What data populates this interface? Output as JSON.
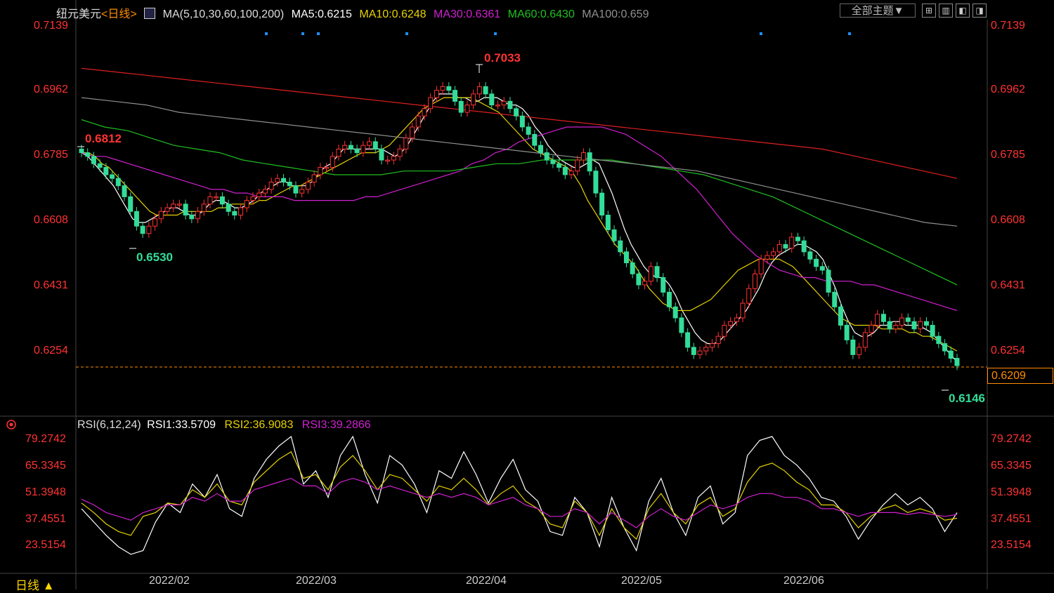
{
  "header": {
    "symbol": "纽元美元",
    "period": "<日线>",
    "ma_label": "MA(5,10,30,60,100,200)",
    "ma5": "MA5:0.6215",
    "ma10": "MA10:0.6248",
    "ma30": "MA30:0.6361",
    "ma60": "MA60:0.6430",
    "ma100": "MA100:0.659",
    "theme_button": "全部主题▼",
    "tool_icons": [
      "grid-icon",
      "layout-icon",
      "panel-left-icon",
      "panel-right-icon"
    ]
  },
  "colors": {
    "up": "#ff3333",
    "down": "#33dd99",
    "ma5": "#ffffff",
    "ma10": "#e6d200",
    "ma30": "#d020d0",
    "ma60": "#20c020",
    "ma100": "#909090",
    "ma200": "#e02020",
    "last_line": "#ff8c00"
  },
  "price_axis": {
    "ticks": [
      "0.7139",
      "0.6962",
      "0.6785",
      "0.6608",
      "0.6431",
      "0.6254"
    ],
    "last_price": "0.6209"
  },
  "annotations": {
    "high": "0.7033",
    "low_left": "0.6530",
    "left_start": "0.6812",
    "recent_low": "0.6146"
  },
  "rsi": {
    "label": "RSI(6,12,24)",
    "rsi1": "RSI1:33.5709",
    "rsi2": "RSI2:36.9083",
    "rsi3": "RSI3:39.2866",
    "ticks": [
      "79.2742",
      "65.3345",
      "51.3948",
      "37.4551",
      "23.5154"
    ]
  },
  "x_axis": {
    "dates": [
      "2022/02",
      "2022/03",
      "2022/04",
      "2022/05",
      "2022/06"
    ]
  },
  "footer": {
    "period_button": "日线 ▲"
  },
  "chart_data": [
    {
      "type": "candlestick",
      "title": "纽元美元 <日线>",
      "ylim": [
        0.612,
        0.716
      ],
      "series": [
        {
          "name": "close",
          "values": [
            0.679,
            0.678,
            0.676,
            0.675,
            0.673,
            0.672,
            0.67,
            0.667,
            0.663,
            0.659,
            0.657,
            0.659,
            0.661,
            0.663,
            0.664,
            0.665,
            0.665,
            0.662,
            0.661,
            0.663,
            0.665,
            0.667,
            0.667,
            0.665,
            0.663,
            0.662,
            0.664,
            0.666,
            0.667,
            0.668,
            0.669,
            0.671,
            0.672,
            0.671,
            0.67,
            0.668,
            0.669,
            0.671,
            0.673,
            0.675,
            0.675,
            0.678,
            0.68,
            0.681,
            0.68,
            0.679,
            0.681,
            0.682,
            0.68,
            0.677,
            0.677,
            0.678,
            0.68,
            0.683,
            0.686,
            0.689,
            0.691,
            0.694,
            0.696,
            0.697,
            0.696,
            0.693,
            0.69,
            0.692,
            0.695,
            0.697,
            0.695,
            0.692,
            0.692,
            0.693,
            0.691,
            0.689,
            0.686,
            0.684,
            0.681,
            0.679,
            0.677,
            0.676,
            0.675,
            0.673,
            0.674,
            0.677,
            0.679,
            0.674,
            0.668,
            0.662,
            0.658,
            0.655,
            0.652,
            0.649,
            0.646,
            0.643,
            0.644,
            0.648,
            0.645,
            0.641,
            0.637,
            0.634,
            0.63,
            0.626,
            0.624,
            0.625,
            0.626,
            0.627,
            0.629,
            0.632,
            0.633,
            0.634,
            0.638,
            0.642,
            0.646,
            0.65,
            0.651,
            0.652,
            0.654,
            0.653,
            0.656,
            0.655,
            0.652,
            0.65,
            0.648,
            0.647,
            0.641,
            0.637,
            0.632,
            0.628,
            0.624,
            0.626,
            0.63,
            0.632,
            0.635,
            0.633,
            0.631,
            0.632,
            0.634,
            0.633,
            0.631,
            0.633,
            0.632,
            0.629,
            0.627,
            0.625,
            0.623,
            0.621
          ]
        },
        {
          "name": "MA5",
          "values": [
            0.679,
            0.678,
            0.676,
            0.674,
            0.672,
            0.67,
            0.667,
            0.664,
            0.661,
            0.66,
            0.66,
            0.661,
            0.662,
            0.663,
            0.664,
            0.664,
            0.663,
            0.662,
            0.662,
            0.663,
            0.665,
            0.666,
            0.666,
            0.665,
            0.664,
            0.664,
            0.665,
            0.666,
            0.668,
            0.669,
            0.67,
            0.671,
            0.671,
            0.67,
            0.67,
            0.67,
            0.671,
            0.673,
            0.675,
            0.676,
            0.678,
            0.68,
            0.68,
            0.68,
            0.68,
            0.68,
            0.68,
            0.68,
            0.679,
            0.678,
            0.679,
            0.681,
            0.684,
            0.687,
            0.69,
            0.693,
            0.695,
            0.695,
            0.695,
            0.694,
            0.694,
            0.693,
            0.693,
            0.694,
            0.694,
            0.694,
            0.693,
            0.692,
            0.692,
            0.691,
            0.689,
            0.686,
            0.684,
            0.681,
            0.679,
            0.677,
            0.676,
            0.675,
            0.675,
            0.676,
            0.677,
            0.676,
            0.672,
            0.668,
            0.663,
            0.658,
            0.654,
            0.651,
            0.648,
            0.646,
            0.645,
            0.645,
            0.643,
            0.64,
            0.636,
            0.633,
            0.63,
            0.628,
            0.627,
            0.627,
            0.628,
            0.63,
            0.632,
            0.634,
            0.636,
            0.639,
            0.642,
            0.646,
            0.649,
            0.651,
            0.652,
            0.653,
            0.654,
            0.654,
            0.653,
            0.652,
            0.65,
            0.646,
            0.642,
            0.637,
            0.633,
            0.63,
            0.629,
            0.629,
            0.63,
            0.632,
            0.632,
            0.633,
            0.633,
            0.632,
            0.632,
            0.632,
            0.631,
            0.63,
            0.628,
            0.626,
            0.624,
            0.622
          ]
        },
        {
          "name": "MA10",
          "values": [
            0.679,
            0.679,
            0.678,
            0.676,
            0.675,
            0.673,
            0.671,
            0.669,
            0.667,
            0.665,
            0.663,
            0.662,
            0.662,
            0.662,
            0.662,
            0.663,
            0.663,
            0.663,
            0.663,
            0.663,
            0.664,
            0.664,
            0.665,
            0.665,
            0.665,
            0.665,
            0.666,
            0.666,
            0.667,
            0.668,
            0.669,
            0.67,
            0.67,
            0.671,
            0.672,
            0.673,
            0.674,
            0.675,
            0.676,
            0.677,
            0.678,
            0.679,
            0.679,
            0.679,
            0.68,
            0.681,
            0.683,
            0.685,
            0.687,
            0.689,
            0.691,
            0.692,
            0.693,
            0.694,
            0.694,
            0.694,
            0.694,
            0.694,
            0.693,
            0.692,
            0.691,
            0.69,
            0.688,
            0.686,
            0.684,
            0.682,
            0.68,
            0.679,
            0.678,
            0.677,
            0.676,
            0.675,
            0.673,
            0.67,
            0.666,
            0.663,
            0.66,
            0.657,
            0.654,
            0.652,
            0.65,
            0.648,
            0.645,
            0.642,
            0.64,
            0.638,
            0.637,
            0.636,
            0.636,
            0.636,
            0.637,
            0.638,
            0.639,
            0.641,
            0.643,
            0.645,
            0.647,
            0.648,
            0.649,
            0.65,
            0.65,
            0.65,
            0.65,
            0.649,
            0.648,
            0.646,
            0.644,
            0.642,
            0.64,
            0.638,
            0.636,
            0.634,
            0.633,
            0.632,
            0.632,
            0.632,
            0.632,
            0.631,
            0.631,
            0.631,
            0.631,
            0.63,
            0.63,
            0.629,
            0.629,
            0.628,
            0.627,
            0.626,
            0.625
          ]
        },
        {
          "name": "MA30",
          "values": [
            0.679,
            0.678,
            0.678,
            0.677,
            0.676,
            0.675,
            0.674,
            0.673,
            0.672,
            0.671,
            0.67,
            0.669,
            0.669,
            0.668,
            0.668,
            0.667,
            0.667,
            0.667,
            0.666,
            0.666,
            0.666,
            0.666,
            0.666,
            0.666,
            0.667,
            0.667,
            0.668,
            0.669,
            0.67,
            0.671,
            0.672,
            0.673,
            0.674,
            0.676,
            0.677,
            0.679,
            0.68,
            0.682,
            0.683,
            0.684,
            0.685,
            0.686,
            0.686,
            0.686,
            0.686,
            0.685,
            0.684,
            0.682,
            0.68,
            0.678,
            0.675,
            0.672,
            0.669,
            0.665,
            0.661,
            0.657,
            0.654,
            0.651,
            0.649,
            0.647,
            0.646,
            0.645,
            0.645,
            0.644,
            0.644,
            0.644,
            0.643,
            0.643,
            0.642,
            0.641,
            0.64,
            0.639,
            0.638,
            0.637,
            0.636
          ]
        },
        {
          "name": "MA60",
          "values": [
            0.688,
            0.686,
            0.685,
            0.683,
            0.681,
            0.68,
            0.679,
            0.677,
            0.676,
            0.675,
            0.674,
            0.673,
            0.673,
            0.673,
            0.674,
            0.674,
            0.674,
            0.675,
            0.676,
            0.676,
            0.677,
            0.677,
            0.677,
            0.677,
            0.676,
            0.675,
            0.674,
            0.673,
            0.671,
            0.669,
            0.667,
            0.664,
            0.661,
            0.658,
            0.655,
            0.652,
            0.649,
            0.646,
            0.643
          ]
        },
        {
          "name": "MA100",
          "values": [
            0.694,
            0.693,
            0.692,
            0.69,
            0.689,
            0.688,
            0.687,
            0.686,
            0.685,
            0.684,
            0.683,
            0.682,
            0.681,
            0.68,
            0.679,
            0.678,
            0.677,
            0.676,
            0.675,
            0.674,
            0.672,
            0.67,
            0.668,
            0.666,
            0.664,
            0.662,
            0.66,
            0.659
          ]
        },
        {
          "name": "MA200",
          "values": [
            0.702,
            0.701,
            0.7,
            0.699,
            0.698,
            0.697,
            0.696,
            0.695,
            0.694,
            0.693,
            0.692,
            0.691,
            0.69,
            0.689,
            0.688,
            0.687,
            0.686,
            0.685,
            0.684,
            0.683,
            0.682,
            0.681,
            0.68,
            0.678,
            0.676,
            0.674,
            0.672
          ]
        }
      ]
    },
    {
      "type": "line",
      "title": "RSI(6,12,24)",
      "ylim": [
        15,
        85
      ],
      "series": [
        {
          "name": "RSI1",
          "values": [
            42,
            35,
            28,
            22,
            18,
            20,
            35,
            45,
            40,
            55,
            48,
            60,
            42,
            38,
            58,
            68,
            75,
            80,
            55,
            62,
            48,
            70,
            80,
            60,
            45,
            70,
            65,
            55,
            40,
            62,
            58,
            72,
            60,
            45,
            58,
            68,
            52,
            46,
            30,
            28,
            48,
            40,
            22,
            48,
            32,
            20,
            46,
            58,
            40,
            28,
            48,
            54,
            34,
            40,
            70,
            78,
            80,
            70,
            65,
            58,
            48,
            46,
            38,
            26,
            36,
            44,
            50,
            44,
            48,
            42,
            30,
            40
          ]
        },
        {
          "name": "RSI2",
          "values": [
            45,
            40,
            34,
            30,
            28,
            38,
            40,
            45,
            44,
            52,
            48,
            55,
            46,
            44,
            56,
            62,
            68,
            72,
            58,
            60,
            52,
            64,
            70,
            62,
            52,
            60,
            58,
            52,
            46,
            54,
            52,
            58,
            52,
            44,
            50,
            54,
            46,
            42,
            34,
            32,
            46,
            40,
            28,
            42,
            32,
            26,
            42,
            50,
            40,
            34,
            44,
            48,
            38,
            42,
            56,
            64,
            66,
            62,
            56,
            52,
            44,
            44,
            40,
            32,
            38,
            42,
            44,
            40,
            42,
            40,
            36,
            37
          ]
        },
        {
          "name": "RSI3",
          "values": [
            47,
            44,
            40,
            38,
            36,
            40,
            42,
            44,
            44,
            48,
            46,
            50,
            46,
            46,
            52,
            54,
            56,
            58,
            54,
            54,
            50,
            56,
            58,
            56,
            52,
            54,
            52,
            50,
            48,
            50,
            48,
            50,
            48,
            44,
            46,
            48,
            44,
            42,
            38,
            38,
            42,
            40,
            34,
            40,
            36,
            32,
            38,
            42,
            38,
            36,
            40,
            44,
            42,
            44,
            48,
            50,
            50,
            48,
            48,
            46,
            42,
            42,
            40,
            38,
            40,
            40,
            40,
            39,
            40,
            39,
            38,
            39
          ]
        }
      ]
    }
  ]
}
